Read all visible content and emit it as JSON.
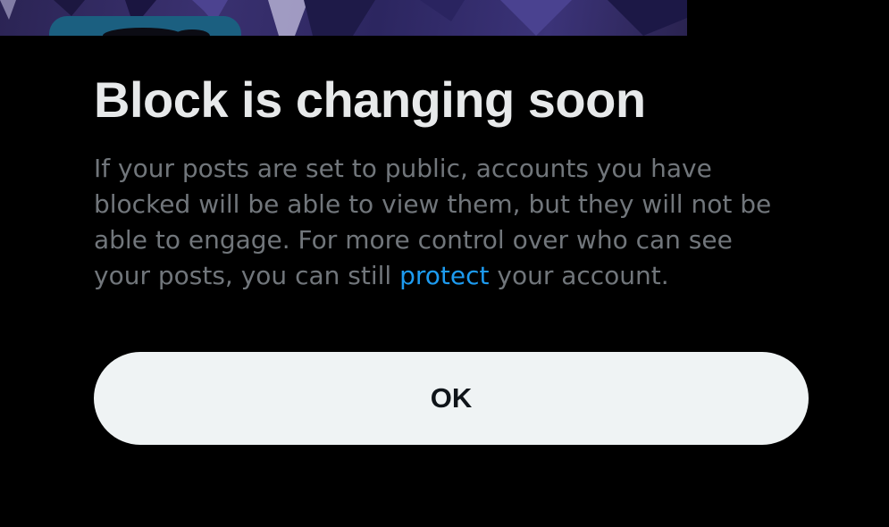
{
  "dialog": {
    "title": "Block is changing soon",
    "body_parts": {
      "before_link": "If your posts are set to public, accounts you have blocked will be able to view them, but they will not be able to engage. For more control over who can see your posts, you can still ",
      "link": "protect",
      "after_link": " your account."
    },
    "ok_label": "OK"
  },
  "colors": {
    "background": "#000000",
    "title": "#e7e9ea",
    "body": "#71767b",
    "link": "#1d9bf0",
    "button_bg": "#eff3f4",
    "button_text": "#0f1419"
  }
}
